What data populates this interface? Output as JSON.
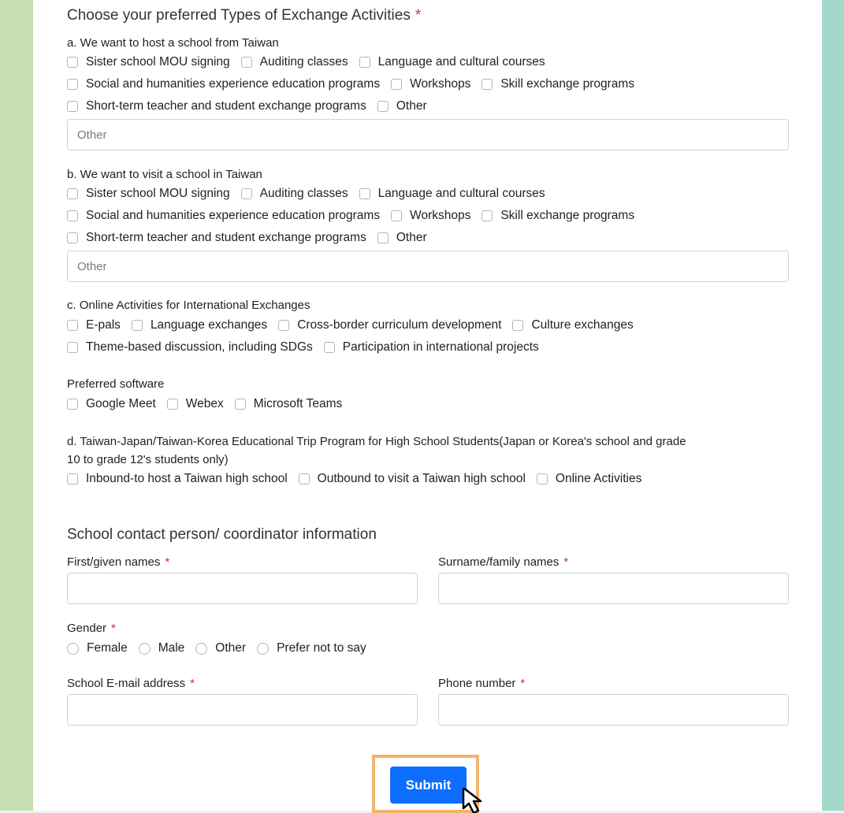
{
  "section1": {
    "title": "Choose your preferred Types of Exchange Activities",
    "required": "*",
    "a": {
      "label": "a. We want to host a school from Taiwan",
      "rows": [
        [
          "Sister school MOU signing",
          "Auditing classes",
          "Language and cultural courses"
        ],
        [
          "Social and humanities experience education programs",
          "Workshops",
          "Skill exchange programs"
        ],
        [
          "Short-term teacher and student exchange programs",
          "Other"
        ]
      ],
      "other_placeholder": "Other"
    },
    "b": {
      "label": "b. We want to visit a school in Taiwan",
      "rows": [
        [
          "Sister school MOU signing",
          "Auditing classes",
          "Language and cultural courses"
        ],
        [
          "Social and humanities experience education programs",
          "Workshops",
          "Skill exchange programs"
        ],
        [
          "Short-term teacher and student exchange programs",
          "Other"
        ]
      ],
      "other_placeholder": "Other"
    },
    "c": {
      "label": "c. Online Activities for International Exchanges",
      "rows": [
        [
          "E-pals",
          "Language exchanges",
          "Cross-border curriculum development",
          "Culture exchanges"
        ],
        [
          "Theme-based discussion, including SDGs",
          "Participation in international projects"
        ]
      ]
    },
    "software": {
      "label": "Preferred software",
      "rows": [
        [
          "Google Meet",
          "Webex",
          "Microsoft Teams"
        ]
      ]
    },
    "d": {
      "label_line1": "d. Taiwan-Japan/Taiwan-Korea Educational Trip Program for High School Students(Japan or Korea's school and grade",
      "label_line2": "10 to grade 12's students only)",
      "rows": [
        [
          "Inbound-to host a Taiwan high school",
          "Outbound to visit a Taiwan high school",
          "Online Activities"
        ]
      ]
    }
  },
  "contact": {
    "title": "School contact person/ coordinator information",
    "required": "*",
    "first_name_label": "First/given names",
    "surname_label": "Surname/family names",
    "gender_label": "Gender",
    "gender_options": [
      "Female",
      "Male",
      "Other",
      "Prefer not to say"
    ],
    "email_label": "School E-mail address",
    "phone_label": "Phone number"
  },
  "submit_label": "Submit",
  "colors": {
    "left_stripe": "#c6dfb1",
    "right_stripe": "#a3d8cc",
    "submit": "#0d6efd",
    "highlight": "#f0b56c",
    "required": "#e0262f"
  }
}
